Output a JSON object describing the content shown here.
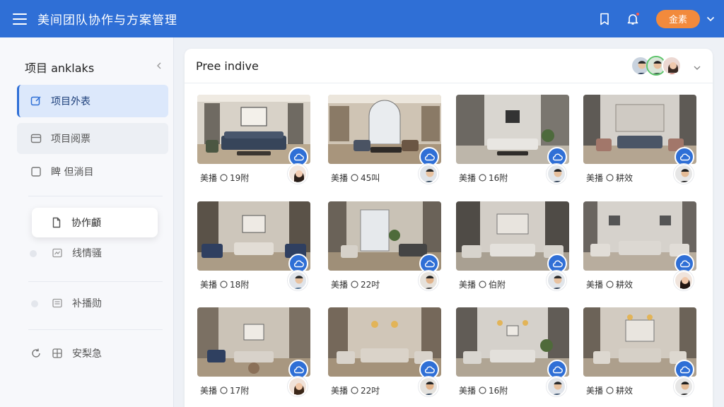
{
  "header": {
    "title": "美间团队协作与方案管理",
    "user_label": "金素",
    "colors": {
      "bar": "#2f6fd6",
      "pill": "#f28a3c"
    }
  },
  "sidebar": {
    "heading": "项目 anklaks",
    "items": [
      {
        "label": "项目外表",
        "icon": "edit-square-icon"
      },
      {
        "label": "项目阅票",
        "icon": "document-icon"
      },
      {
        "label": "睥 但淌目",
        "icon": "checkbox-icon"
      },
      {
        "label": "协作顱",
        "icon": "file-icon"
      },
      {
        "label": "线情骚",
        "icon": "chart-icon"
      },
      {
        "label": "补播勋",
        "icon": "list-icon"
      },
      {
        "label": "安梨急",
        "icon": "grid-icon"
      }
    ]
  },
  "panel": {
    "title": "Pree indive",
    "cards": [
      {
        "label": "美播",
        "count": "19附",
        "owner": "f"
      },
      {
        "label": "美播",
        "count": "45叫",
        "owner": "m"
      },
      {
        "label": "美播",
        "count": "16附",
        "owner": "m"
      },
      {
        "label": "美播",
        "count": "耕效",
        "owner": "m"
      },
      {
        "label": "美播",
        "count": "18附",
        "owner": "m"
      },
      {
        "label": "美播",
        "count": "22吋",
        "owner": "m"
      },
      {
        "label": "美播",
        "count": "伯附",
        "owner": "m"
      },
      {
        "label": "美播",
        "count": "耕效",
        "owner": "f"
      },
      {
        "label": "美播",
        "count": "17附",
        "owner": "f"
      },
      {
        "label": "美播",
        "count": "22吋",
        "owner": "m"
      },
      {
        "label": "美播",
        "count": "16附",
        "owner": "m"
      },
      {
        "label": "美播",
        "count": "耕效",
        "owner": "m"
      }
    ]
  }
}
